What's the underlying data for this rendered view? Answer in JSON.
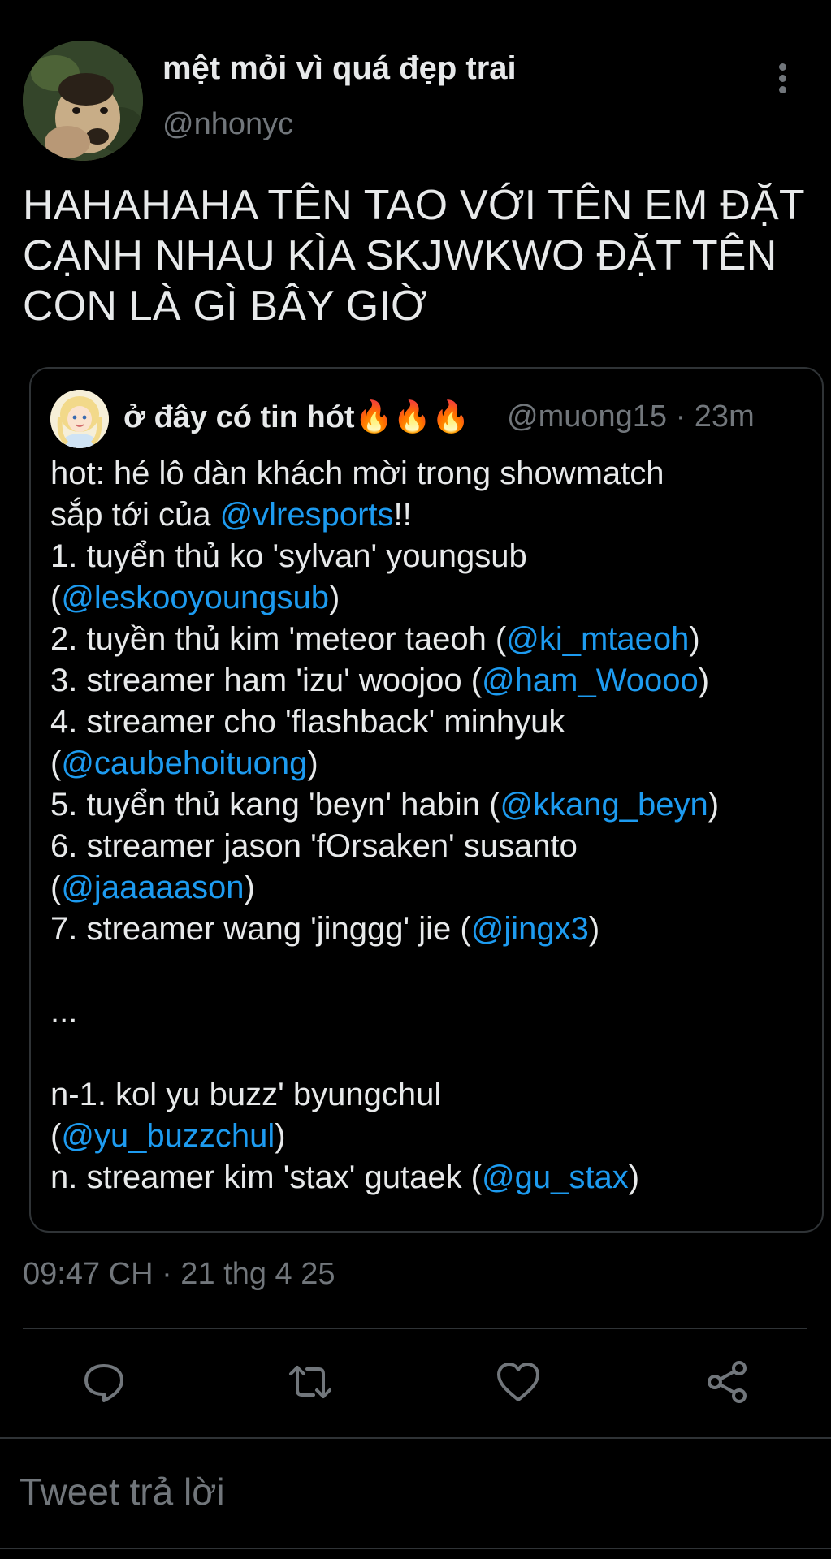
{
  "author": {
    "display_name": "mệt mỏi vì quá đẹp trai",
    "handle": "@nhonyc"
  },
  "tweet": {
    "lines": [
      "HAHAHAHA TÊN TAO VỚI TÊN EM ĐẶT",
      "CẠNH NHAU KÌA SKJWKWO ĐẶT TÊN",
      "CON LÀ GÌ BÂY GIỜ"
    ]
  },
  "quote": {
    "display_name": "ở đây có tin hót🔥🔥🔥",
    "meta": "@muong15 · 23m",
    "lines": [
      [
        {
          "t": "hot: hé lô dàn khách mời trong showmatch"
        }
      ],
      [
        {
          "t": "sắp tới của "
        },
        {
          "t": "@vlresports",
          "m": true
        },
        {
          "t": "!!"
        }
      ],
      [
        {
          "t": "1. tuyển thủ ko 'sylvan' youngsub"
        }
      ],
      [
        {
          "t": "("
        },
        {
          "t": "@leskooyoungsub",
          "m": true
        },
        {
          "t": ")"
        }
      ],
      [
        {
          "t": "2. tuyền thủ kim 'meteor taeoh ("
        },
        {
          "t": "@ki_mtaeoh",
          "m": true
        },
        {
          "t": ")"
        }
      ],
      [
        {
          "t": "3. streamer ham 'izu' woojoo ("
        },
        {
          "t": "@ham_Woooo",
          "m": true
        },
        {
          "t": ")"
        }
      ],
      [
        {
          "t": "4. streamer cho 'flashback' minhyuk"
        }
      ],
      [
        {
          "t": "("
        },
        {
          "t": "@caubehoituong",
          "m": true
        },
        {
          "t": ")"
        }
      ],
      [
        {
          "t": "5. tuyển thủ kang 'beyn' habin ("
        },
        {
          "t": "@kkang_beyn",
          "m": true
        },
        {
          "t": ")"
        }
      ],
      [
        {
          "t": "6. streamer jason 'fOrsaken' susanto"
        }
      ],
      [
        {
          "t": "("
        },
        {
          "t": "@jaaaaason",
          "m": true
        },
        {
          "t": ")"
        }
      ],
      [
        {
          "t": "7. streamer wang 'jinggg' jie ("
        },
        {
          "t": "@jingx3",
          "m": true
        },
        {
          "t": ")"
        }
      ],
      [
        {
          "t": ""
        }
      ],
      [
        {
          "t": "..."
        }
      ],
      [
        {
          "t": ""
        }
      ],
      [
        {
          "t": "n-1. kol yu buzz' byungchul"
        }
      ],
      [
        {
          "t": "("
        },
        {
          "t": "@yu_buzzchul",
          "m": true
        },
        {
          "t": ")"
        }
      ],
      [
        {
          "t": "n. streamer kim 'stax' gutaek ("
        },
        {
          "t": "@gu_stax",
          "m": true
        },
        {
          "t": ")"
        }
      ]
    ]
  },
  "timestamp": "09:47 CH · 21 thg 4 25",
  "actions": [
    {
      "name": "reply-icon"
    },
    {
      "name": "retweet-icon"
    },
    {
      "name": "like-icon"
    },
    {
      "name": "share-icon"
    }
  ],
  "reply_placeholder": "Tweet trả lời",
  "colors": {
    "background": "#000000",
    "text": "#e7e9ea",
    "muted": "#71767b",
    "mention": "#1d9bf0",
    "border": "#2f3336"
  }
}
